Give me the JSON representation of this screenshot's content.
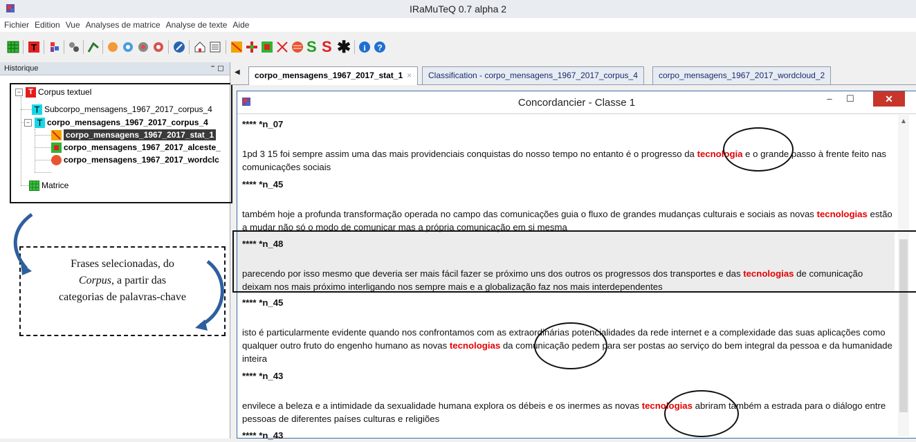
{
  "window": {
    "title": "IRaMuTeQ 0.7 alpha 2"
  },
  "menu": [
    "Fichier",
    "Edition",
    "Vue",
    "Analyses de matrice",
    "Analyse de texte",
    "Aide"
  ],
  "toolbar_icons": [
    "matrix-icon",
    "text-corpus-icon",
    "iramuteq-icon",
    "settings-icon",
    "stat-icon",
    "frequency-icon",
    "chi2-icon",
    "similarity-icon",
    "help-icon",
    "home-icon",
    "list-icon",
    "specificities-icon",
    "reinert-icon",
    "alceste-icon",
    "similarities-icon",
    "wordcloud-icon",
    "subcorpus-s-icon",
    "subcorpus-s2-icon",
    "asterisk-icon",
    "info-icon",
    "about-icon"
  ],
  "history": {
    "label": "Historique",
    "controls": "⁼ ◻",
    "items": [
      {
        "label": "Corpus textuel",
        "icon": "text-corpus-icon"
      },
      {
        "label": "Subcorpo_mensagens_1967_2017_corpus_4",
        "icon": "text-icon"
      },
      {
        "label": "corpo_mensagens_1967_2017_corpus_4",
        "icon": "text-icon"
      },
      {
        "label": "corpo_mensagens_1967_2017_stat_1",
        "icon": "stat-icon"
      },
      {
        "label": "corpo_mensagens_1967_2017_alceste_",
        "icon": "alceste-icon"
      },
      {
        "label": "corpo_mensagens_1967_2017_wordclc",
        "icon": "wordcloud-icon"
      },
      {
        "label": "Matrice",
        "icon": "matrix-icon"
      }
    ]
  },
  "callout": {
    "line1": "Frases selecionadas, do",
    "line2": "Corpus",
    "line2_rest": ", a partir das",
    "line3": "categorias de palavras-chave"
  },
  "tabs": [
    {
      "label": "corpo_mensagens_1967_2017_stat_1",
      "close": "×"
    },
    {
      "label": "Classification - corpo_mensagens_1967_2017_corpus_4"
    },
    {
      "label": "corpo_mensagens_1967_2017_wordcloud_2"
    }
  ],
  "concordancer": {
    "title": "Concordancier - Classe 1",
    "entries": [
      {
        "header": "**** *n_07",
        "pre": "1pd 3 15 foi sempre assim uma das mais providenciais conquistas do nosso tempo no entanto é o progresso da ",
        "kw": "tecnologia",
        "post": " e o grande passo à frente feito nas comunicações sociais"
      },
      {
        "header": "**** *n_45",
        "pre": "também hoje a profunda transformação operada no campo das comunicações guia o fluxo de grandes mudanças culturais e sociais as novas ",
        "kw": "tecnologias",
        "post": " estão a mudar não só o modo de comunicar mas a própria comunicação em si mesma"
      },
      {
        "header": "**** *n_48",
        "pre": "parecendo por isso mesmo que deveria ser mais fácil fazer se próximo uns dos outros os progressos dos transportes e das ",
        "kw": "tecnologias",
        "post": " de comunicação deixam nos mais próximo interligando nos sempre mais e a globalização faz nos mais interdependentes"
      },
      {
        "header": "**** *n_45",
        "pre": "isto é particularmente evidente quando nos confrontamos com as extraordinárias potencialidades da rede internet e a complexidade das suas aplicações como qualquer outro fruto do engenho humano as novas ",
        "kw": "tecnologias",
        "post": " da comunicação pedem para ser postas ao serviço do bem integral da pessoa e da humanidade inteira"
      },
      {
        "header": "**** *n_43",
        "pre": "envilece a beleza e a intimidade da sexualidade humana explora os débeis e os inermes as novas ",
        "kw": "tecnologias",
        "post": " abriram também a estrada para o diálogo entre pessoas de diferentes países culturas e religiões"
      },
      {
        "header": "**** *n_43"
      }
    ]
  },
  "colors": {
    "keyword": "#e30000",
    "close_button": "#c7352b"
  }
}
